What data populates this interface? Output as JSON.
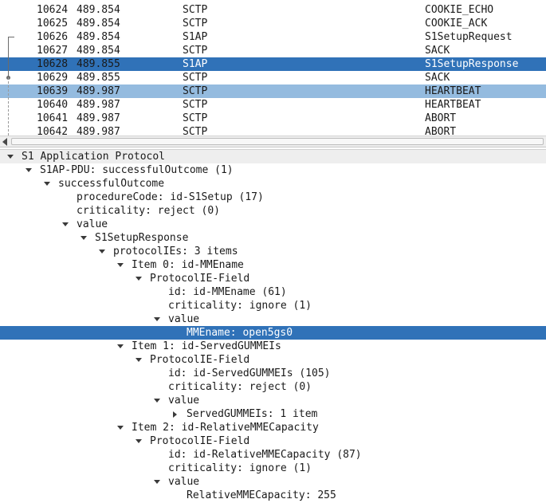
{
  "packets": [
    {
      "no": "10624",
      "time": "489.854",
      "proto": "SCTP",
      "info": "COOKIE_ECHO"
    },
    {
      "no": "10625",
      "time": "489.854",
      "proto": "SCTP",
      "info": "COOKIE_ACK"
    },
    {
      "no": "10626",
      "time": "489.854",
      "proto": "S1AP",
      "info": "S1SetupRequest"
    },
    {
      "no": "10627",
      "time": "489.854",
      "proto": "SCTP",
      "info": "SACK"
    },
    {
      "no": "10628",
      "time": "489.855",
      "proto": "S1AP",
      "info": "S1SetupResponse",
      "state": "selected"
    },
    {
      "no": "10629",
      "time": "489.855",
      "proto": "SCTP",
      "info": "SACK"
    },
    {
      "no": "10639",
      "time": "489.987",
      "proto": "SCTP",
      "info": "HEARTBEAT",
      "state": "highlighted"
    },
    {
      "no": "10640",
      "time": "489.987",
      "proto": "SCTP",
      "info": "HEARTBEAT"
    },
    {
      "no": "10641",
      "time": "489.987",
      "proto": "SCTP",
      "info": "ABORT"
    },
    {
      "no": "10642",
      "time": "489.987",
      "proto": "SCTP",
      "info": "ABORT"
    }
  ],
  "details": [
    {
      "level": 0,
      "expand": "down",
      "text": "S1 Application Protocol"
    },
    {
      "level": 1,
      "expand": "down",
      "text": "S1AP-PDU: successfulOutcome (1)"
    },
    {
      "level": 2,
      "expand": "down",
      "text": "successfulOutcome"
    },
    {
      "level": 3,
      "expand": "none",
      "text": "procedureCode: id-S1Setup (17)"
    },
    {
      "level": 3,
      "expand": "none",
      "text": "criticality: reject (0)"
    },
    {
      "level": 3,
      "expand": "down",
      "text": "value"
    },
    {
      "level": 4,
      "expand": "down",
      "text": "S1SetupResponse"
    },
    {
      "level": 5,
      "expand": "down",
      "text": "protocolIEs: 3 items"
    },
    {
      "level": 6,
      "expand": "down",
      "text": "Item 0: id-MMEname"
    },
    {
      "level": 7,
      "expand": "down",
      "text": "ProtocolIE-Field"
    },
    {
      "level": 8,
      "expand": "none",
      "text": "id: id-MMEname (61)"
    },
    {
      "level": 8,
      "expand": "none",
      "text": "criticality: ignore (1)"
    },
    {
      "level": 8,
      "expand": "down",
      "text": "value"
    },
    {
      "level": 9,
      "expand": "none",
      "text": "MMEname: open5gs0",
      "state": "selected"
    },
    {
      "level": 6,
      "expand": "down",
      "text": "Item 1: id-ServedGUMMEIs"
    },
    {
      "level": 7,
      "expand": "down",
      "text": "ProtocolIE-Field"
    },
    {
      "level": 8,
      "expand": "none",
      "text": "id: id-ServedGUMMEIs (105)"
    },
    {
      "level": 8,
      "expand": "none",
      "text": "criticality: reject (0)"
    },
    {
      "level": 8,
      "expand": "down",
      "text": "value"
    },
    {
      "level": 9,
      "expand": "right",
      "text": "ServedGUMMEIs: 1 item"
    },
    {
      "level": 6,
      "expand": "down",
      "text": "Item 2: id-RelativeMMECapacity"
    },
    {
      "level": 7,
      "expand": "down",
      "text": "ProtocolIE-Field"
    },
    {
      "level": 8,
      "expand": "none",
      "text": "id: id-RelativeMMECapacity (87)"
    },
    {
      "level": 8,
      "expand": "none",
      "text": "criticality: ignore (1)"
    },
    {
      "level": 8,
      "expand": "down",
      "text": "value"
    },
    {
      "level": 9,
      "expand": "none",
      "text": "RelativeMMECapacity: 255"
    }
  ],
  "icons": {
    "expanded": "triangle-down-icon",
    "collapsed": "triangle-right-icon",
    "scroll_left": "arrow-left-icon"
  },
  "colors": {
    "selection": "#3072b8",
    "highlight": "#94bbdf",
    "header_bg": "#eeeeee"
  }
}
